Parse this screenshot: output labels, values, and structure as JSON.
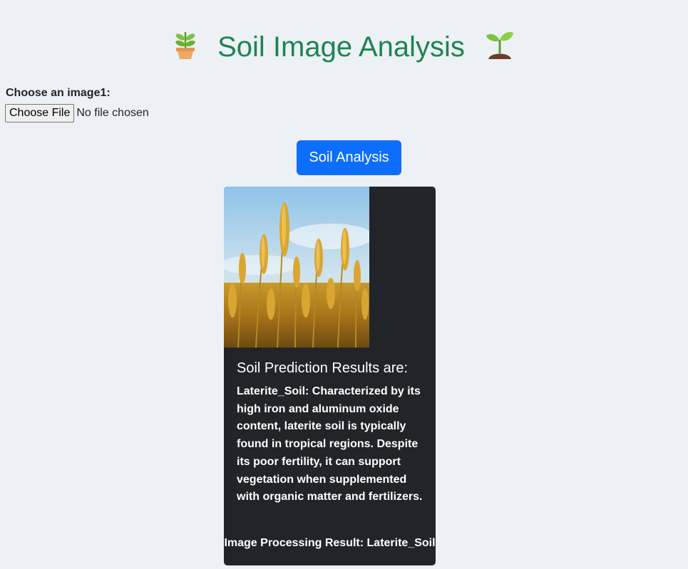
{
  "header": {
    "title": "Soil Image Analysis",
    "left_icon": "potted-plant-icon",
    "right_icon": "seedling-icon"
  },
  "upload": {
    "label": "Choose an image1:",
    "button_label": "Choose File",
    "status": "No file chosen"
  },
  "actions": {
    "analyze_label": "Soil Analysis"
  },
  "result_card": {
    "image": "wheat-field-photo",
    "title": "Soil Prediction Results are:",
    "description": "Laterite_Soil: Characterized by its high iron and aluminum oxide content, laterite soil is typically found in tropical regions. Despite its poor fertility, it can support vegetation when supplemented with organic matter and fertilizers.",
    "processing_result": "Image Processing Result: Laterite_Soil"
  },
  "colors": {
    "background": "#edf1f5",
    "title": "#1e8452",
    "primary_button": "#0d6efd",
    "card": "#212529"
  }
}
